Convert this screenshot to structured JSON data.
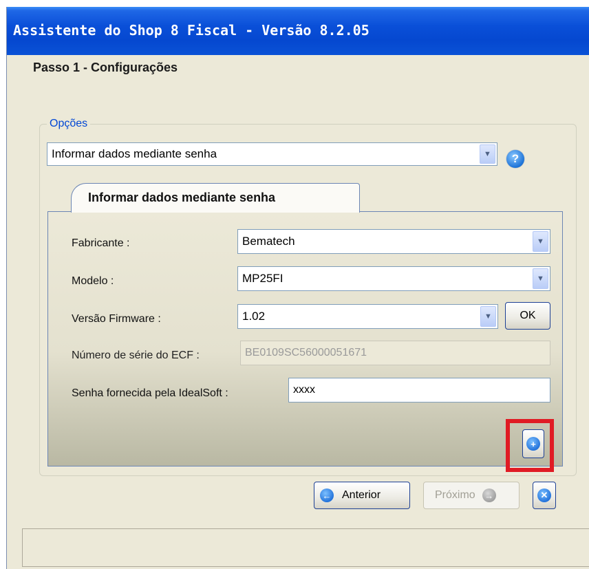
{
  "window": {
    "title": "Assistente do Shop 8 Fiscal - Versão 8.2.05",
    "step_title": "Passo 1 - Configurações"
  },
  "options": {
    "group_label": "Opções",
    "selected": "Informar dados mediante senha",
    "help_icon": "question-icon"
  },
  "tab": {
    "label": "Informar dados mediante senha"
  },
  "form": {
    "fabricante_label": "Fabricante :",
    "fabricante_value": "Bematech",
    "modelo_label": "Modelo :",
    "modelo_value": "MP25FI",
    "firmware_label": "Versão Firmware :",
    "firmware_value": "1.02",
    "ok_label": "OK",
    "serial_label": "Número de série do ECF :",
    "serial_value": "BE0109SC56000051671",
    "senha_label": "Senha fornecida pela IdealSoft :",
    "senha_value": "xxxx",
    "add_icon": "plus-icon"
  },
  "footer": {
    "prev_label": "Anterior",
    "next_label": "Próximo",
    "cancel_icon": "close-icon"
  },
  "colors": {
    "titlebar": "#0a4fd8",
    "highlight": "#e01b24",
    "group_label": "#0046d5"
  }
}
